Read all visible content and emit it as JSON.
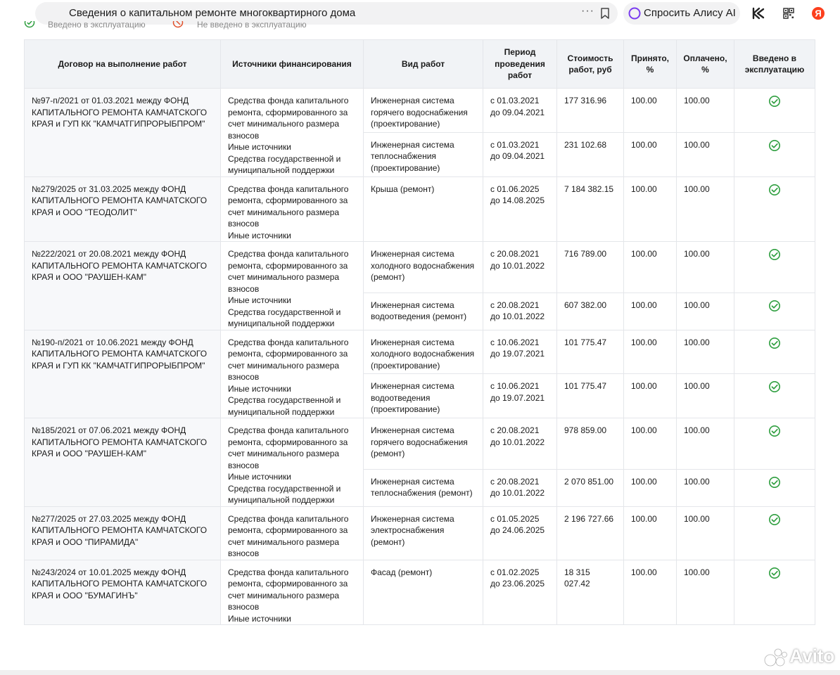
{
  "browser": {
    "page_title": "Сведения о капитальном ремонте многоквартирного дома",
    "alice_label": "Спросить Алису AI",
    "icons": [
      "more-icon",
      "bookmark-icon",
      "alice-icon",
      "kinopoisk-icon",
      "qr-icon",
      "yandex-icon"
    ]
  },
  "legend": {
    "in_service": "Введено в эксплуатацию",
    "not_in_service": "Не введено в эксплуатацию"
  },
  "table": {
    "headers": {
      "contract": "Договор на выполнение работ",
      "sources": "Источники финансирования",
      "work_type": "Вид работ",
      "period": "Период проведения работ",
      "cost": "Стоимость работ, руб",
      "accepted": "Принято, %",
      "paid": "Оплачено, %",
      "commissioned": "Введено в эксплуатацию"
    },
    "contracts": [
      {
        "contract": "№97-п/2021 от 01.03.2021 между ФОНД КАПИТАЛЬНОГО РЕМОНТА КАМЧАТСКОГО КРАЯ и ГУП КК \"КАМЧАТГИПРОРЫБПРОМ\"",
        "sources": [
          "Средства фонда капитального ремонта, сформированного за счет минимального размера взносов",
          "Иные источники",
          "Средства государственной и муниципальной поддержки"
        ],
        "works": [
          {
            "type": "Инженерная система горячего водоснабжения (проектирование)",
            "period": "с 01.03.2021 до 09.04.2021",
            "cost": "177 316.96",
            "accepted": "100.00",
            "paid": "100.00",
            "status": "check-circle-icon"
          },
          {
            "type": "Инженерная система теплоснабжения (проектирование)",
            "period": "с 01.03.2021 до 09.04.2021",
            "cost": "231 102.68",
            "accepted": "100.00",
            "paid": "100.00",
            "status": "check-circle-icon"
          }
        ]
      },
      {
        "contract": "№279/2025 от 31.03.2025 между ФОНД КАПИТАЛЬНОГО РЕМОНТА КАМЧАТСКОГО КРАЯ и ООО \"ТЕОДОЛИТ\"",
        "sources": [
          "Средства фонда капитального ремонта, сформированного за счет минимального размера взносов",
          "Иные источники"
        ],
        "works": [
          {
            "type": "Крыша (ремонт)",
            "period": "с 01.06.2025 до 14.08.2025",
            "cost": "7 184 382.15",
            "accepted": "100.00",
            "paid": "100.00",
            "status": "check-circle-icon"
          }
        ]
      },
      {
        "contract": "№222/2021 от 20.08.2021 между ФОНД КАПИТАЛЬНОГО РЕМОНТА КАМЧАТСКОГО КРАЯ и ООО \"РАУШЕН-КАМ\"",
        "sources": [
          "Средства фонда капитального ремонта, сформированного за счет минимального размера взносов",
          "Иные источники",
          "Средства государственной и муниципальной поддержки"
        ],
        "works": [
          {
            "type": "Инженерная система холодного водоснабжения (ремонт)",
            "period": "с 20.08.2021 до 10.01.2022",
            "cost": "716 789.00",
            "accepted": "100.00",
            "paid": "100.00",
            "status": "check-circle-icon"
          },
          {
            "type": "Инженерная система водоотведения (ремонт)",
            "period": "с 20.08.2021 до 10.01.2022",
            "cost": "607 382.00",
            "accepted": "100.00",
            "paid": "100.00",
            "status": "check-circle-icon"
          }
        ]
      },
      {
        "contract": "№190-п/2021 от 10.06.2021 между ФОНД КАПИТАЛЬНОГО РЕМОНТА КАМЧАТСКОГО КРАЯ и ГУП КК \"КАМЧАТГИПРОРЫБПРОМ\"",
        "sources": [
          "Средства фонда капитального ремонта, сформированного за счет минимального размера взносов",
          "Иные источники",
          "Средства государственной и муниципальной поддержки"
        ],
        "works": [
          {
            "type": "Инженерная система холодного водоснабжения (проектирование)",
            "period": "с 10.06.2021 до 19.07.2021",
            "cost": "101 775.47",
            "accepted": "100.00",
            "paid": "100.00",
            "status": "check-circle-icon"
          },
          {
            "type": "Инженерная система водоотведения (проектирование)",
            "period": "с 10.06.2021 до 19.07.2021",
            "cost": "101 775.47",
            "accepted": "100.00",
            "paid": "100.00",
            "status": "check-circle-icon"
          }
        ]
      },
      {
        "contract": "№185/2021 от 07.06.2021 между ФОНД КАПИТАЛЬНОГО РЕМОНТА КАМЧАТСКОГО КРАЯ и ООО \"РАУШЕН-КАМ\"",
        "sources": [
          "Средства фонда капитального ремонта, сформированного за счет минимального размера взносов",
          "Иные источники",
          "Средства государственной и муниципальной поддержки"
        ],
        "works": [
          {
            "type": "Инженерная система горячего водоснабжения (ремонт)",
            "period": "с 20.08.2021 до 10.01.2022",
            "cost": "978 859.00",
            "accepted": "100.00",
            "paid": "100.00",
            "status": "check-circle-icon"
          },
          {
            "type": "Инженерная система теплоснабжения (ремонт)",
            "period": "с 20.08.2021 до 10.01.2022",
            "cost": "2 070 851.00",
            "accepted": "100.00",
            "paid": "100.00",
            "status": "check-circle-icon"
          }
        ]
      },
      {
        "contract": "№277/2025 от 27.03.2025 между ФОНД КАПИТАЛЬНОГО РЕМОНТА КАМЧАТСКОГО КРАЯ и ООО \"ПИРАМИДА\"",
        "sources": [
          "Средства фонда капитального ремонта, сформированного за счет минимального размера взносов"
        ],
        "works": [
          {
            "type": "Инженерная система электроснабжения (ремонт)",
            "period": "с 01.05.2025 до 24.06.2025",
            "cost": "2 196 727.66",
            "accepted": "100.00",
            "paid": "100.00",
            "status": "check-circle-icon"
          }
        ]
      },
      {
        "contract": "№243/2024 от 10.01.2025 между ФОНД КАПИТАЛЬНОГО РЕМОНТА КАМЧАТСКОГО КРАЯ и ООО \"БУМАГИНЪ\"",
        "sources": [
          "Средства фонда капитального ремонта, сформированного за счет минимального размера взносов",
          "Иные источники"
        ],
        "works": [
          {
            "type": "Фасад (ремонт)",
            "period": "с 01.02.2025 до 23.06.2025",
            "cost": "18 315 027.42",
            "accepted": "100.00",
            "paid": "100.00",
            "status": "check-circle-icon"
          }
        ]
      }
    ]
  },
  "watermark": {
    "text": "Avito"
  },
  "colors": {
    "check_green": "#2e9e3f",
    "header_bg": "#f1f3f6",
    "border": "#e4e6ea",
    "alice_purple": "#7a3cf0",
    "yandex_red": "#fc3f1d"
  }
}
